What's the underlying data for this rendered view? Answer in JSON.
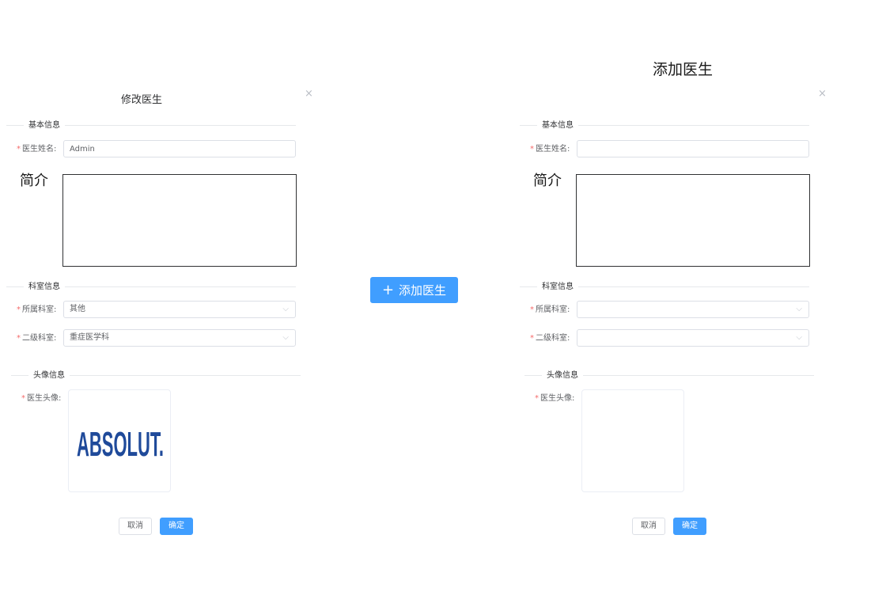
{
  "edit_dialog": {
    "title": "修改医生",
    "close_icon": "×",
    "section_basic": "基本信息",
    "doctor_name_label": "医生姓名:",
    "doctor_name_value": "Admin",
    "intro_label": "简介",
    "section_dept": "科室信息",
    "dept_label": "所属科室:",
    "dept_value": "其他",
    "sub_dept_label": "二级科室:",
    "sub_dept_value": "重症医学科",
    "section_avatar": "头像信息",
    "avatar_label": "医生头像:",
    "avatar_logo_text": "ABSOLUT.",
    "cancel": "取消",
    "confirm": "确定"
  },
  "add_button": {
    "plus": "+",
    "label": "添加医生"
  },
  "add_dialog": {
    "page_title": "添加医生",
    "close_icon": "×",
    "section_basic": "基本信息",
    "doctor_name_label": "医生姓名:",
    "doctor_name_value": "",
    "intro_label": "简介",
    "section_dept": "科室信息",
    "dept_label": "所属科室:",
    "dept_value": "",
    "sub_dept_label": "二级科室:",
    "sub_dept_value": "",
    "section_avatar": "头像信息",
    "avatar_label": "医生头像:",
    "cancel": "取消",
    "confirm": "确定"
  },
  "colors": {
    "primary": "#409eff",
    "required": "#f56c6c",
    "logo_blue": "#1f4a9a"
  },
  "icons": {
    "close": "close-icon",
    "select_arrow": "chevron-down-icon",
    "add": "plus-icon"
  }
}
